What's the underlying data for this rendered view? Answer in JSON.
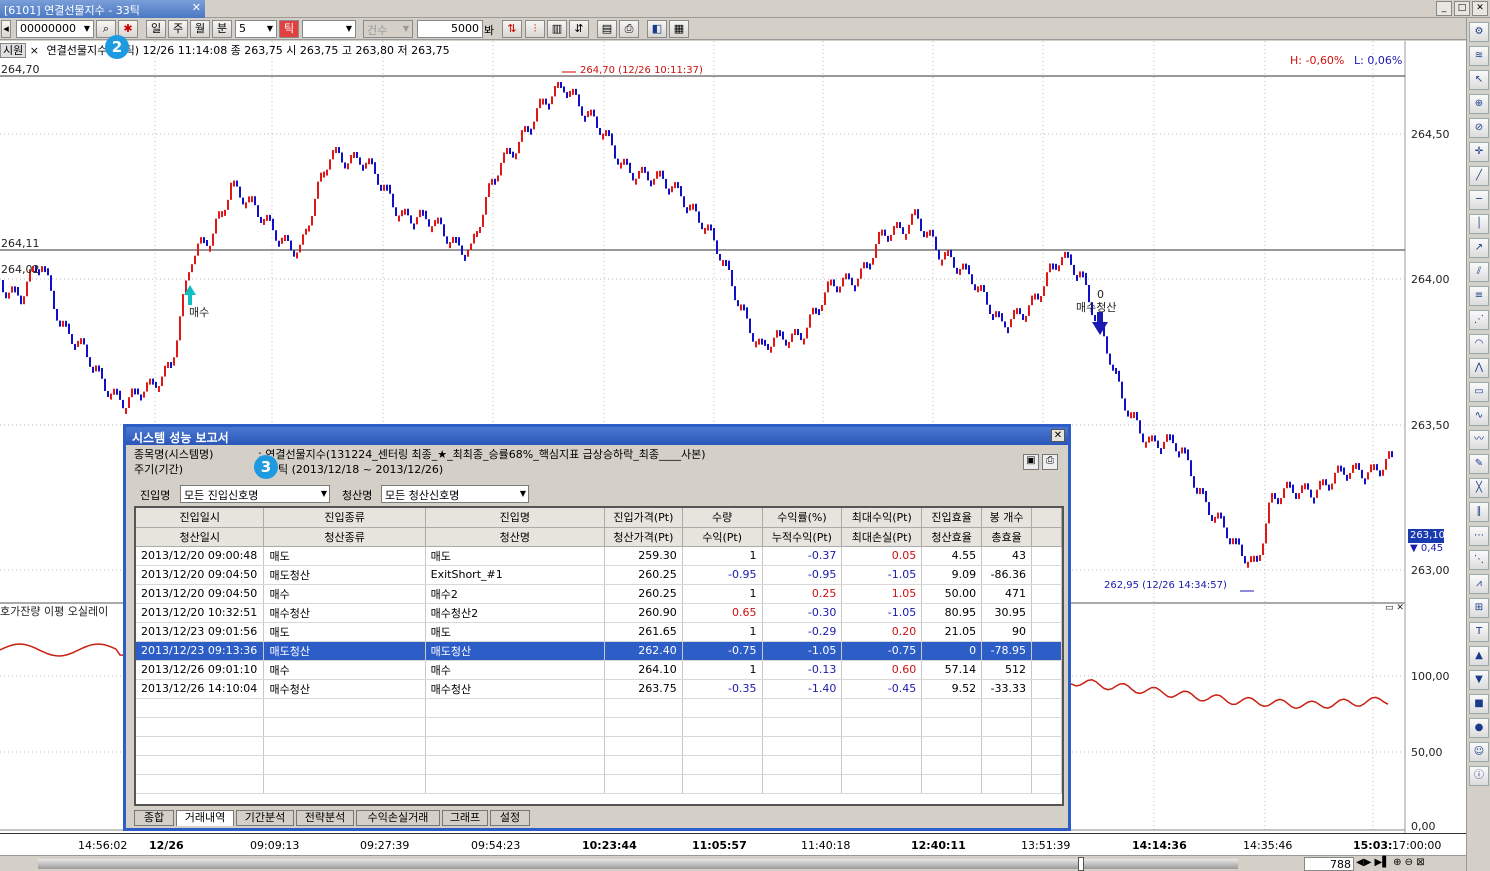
{
  "window": {
    "tab_title": "[6101] 연결선물지수  - 33틱",
    "tab_close": "✕",
    "controls": [
      "_",
      "□",
      "✕"
    ]
  },
  "toolbar": {
    "code": "00000000",
    "periods": [
      "일",
      "주",
      "월",
      "분"
    ],
    "interval": "5",
    "tick_label": "틱",
    "count_mode": "건수",
    "count_value": "5000",
    "count_unit": "봐"
  },
  "chart": {
    "mode_label": "시원",
    "info": "연결선물지수 33틱) 12/26 11:14:08   종 263,75   시 263,75 고 263,80 저 263,75",
    "stats": {
      "h": "H: -0,60%",
      "l": "L: 0,06%"
    },
    "high_label": "264,70",
    "high_annotation": "264,70 (12/26 10:11:37)",
    "low_annotation": "262,95 (12/26 14:34:57)",
    "hline1_label": "264,11",
    "hline2_label": "264,02",
    "current_price": "263,10",
    "current_change": "▼ 0,45",
    "y_ticks": [
      "264,50",
      "264,00",
      "263,50",
      "263,00"
    ],
    "signal_buy": "매수",
    "signal_exit_value": "0",
    "signal_exit": "매수청산",
    "osc_title": "호가잔량 이평 오실레이",
    "osc_ticks": [
      "100,00",
      "50,00",
      "0,00"
    ],
    "x_ticks": [
      "14:56:02",
      "12/26",
      "09:09:13",
      "09:27:39",
      "09:54:23",
      "10:23:44",
      "11:05:57",
      "11:40:18",
      "12:40:11",
      "13:51:39",
      "14:14:36",
      "14:35:46",
      "15:03:",
      "17:00:00"
    ],
    "scroll_count": "788"
  },
  "badges": {
    "b2": "2",
    "b3": "3"
  },
  "dialog": {
    "title": "시스템 성능 보고서",
    "system_label": "종목명(시스템명)",
    "system_value": ": 연결선물지수(131224_센터링 최종_★_최최종_승률68%_핵심지표 급상승하락_최종____사본)",
    "period_label": "주기(기간)",
    "period_value": "틱 (2013/12/18 ~ 2013/12/26)",
    "entry_filter_label": "진입명",
    "entry_filter_value": "모든 진입신호명",
    "exit_filter_label": "청산명",
    "exit_filter_value": "모든 청산신호명",
    "headers_top": [
      "진입일시",
      "진입종류",
      "진입명",
      "진입가격(Pt)",
      "수량",
      "수익률(%)",
      "최대수익(Pt)",
      "진입효율",
      "봉 개수"
    ],
    "headers_bottom": [
      "청산일시",
      "청산종류",
      "청산명",
      "청산가격(Pt)",
      "수익(Pt)",
      "누적수익(Pt)",
      "최대손실(Pt)",
      "청산효율",
      "총효율"
    ],
    "rows": [
      [
        "2013/12/20  09:00:48",
        "매도",
        "매도",
        "259.30",
        "1",
        "-0.37",
        "0.05",
        "4.55",
        "43"
      ],
      [
        "2013/12/20  09:04:50",
        "매도청산",
        "ExitShort_#1",
        "260.25",
        "-0.95",
        "-0.95",
        "-1.05",
        "9.09",
        "-86.36"
      ],
      [
        "2013/12/20  09:04:50",
        "매수",
        "매수2",
        "260.25",
        "1",
        "0.25",
        "1.05",
        "50.00",
        "471"
      ],
      [
        "2013/12/20  10:32:51",
        "매수청산",
        "매수청산2",
        "260.90",
        "0.65",
        "-0.30",
        "-1.05",
        "80.95",
        "30.95"
      ],
      [
        "2013/12/23  09:01:56",
        "매도",
        "매도",
        "261.65",
        "1",
        "-0.29",
        "0.20",
        "21.05",
        "90"
      ],
      [
        "2013/12/23  09:13:36",
        "매도청산",
        "매도청산",
        "262.40",
        "-0.75",
        "-1.05",
        "-0.75",
        "0",
        "-78.95"
      ],
      [
        "2013/12/26  09:01:10",
        "매수",
        "매수",
        "264.10",
        "1",
        "-0.13",
        "0.60",
        "57.14",
        "512"
      ],
      [
        "2013/12/26  14:10:04",
        "매수청산",
        "매수청산",
        "263.75",
        "-0.35",
        "-1.40",
        "-0.45",
        "9.52",
        "-33.33"
      ]
    ],
    "tabs": [
      "종합",
      "거래내역",
      "기간분석",
      "전략분석",
      "수익손실거래",
      "그래프",
      "설정"
    ],
    "active_tab": "거래내역"
  },
  "colors": {
    "up": "#e01818",
    "down": "#1010c8",
    "dialog_border": "#2d5dc7",
    "osc": "#c82010",
    "badge": "#1e9ae0"
  }
}
